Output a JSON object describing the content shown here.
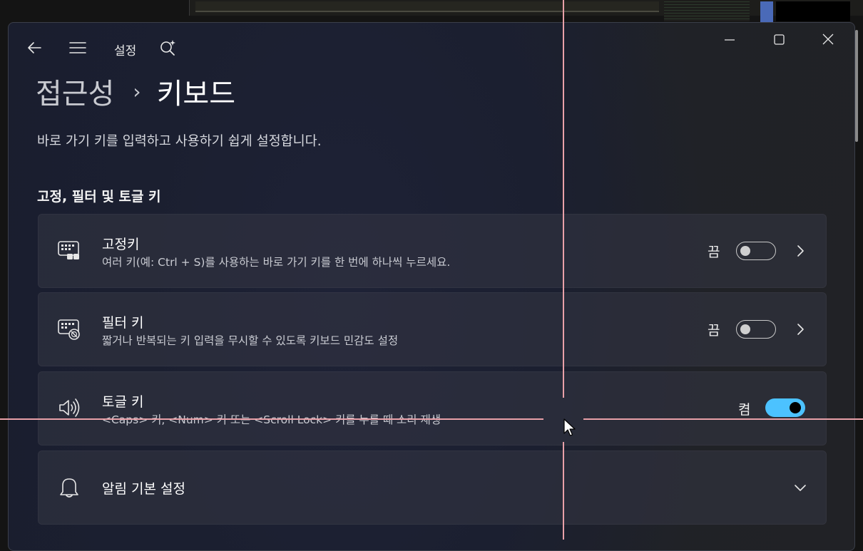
{
  "window": {
    "title": "설정"
  },
  "breadcrumb": {
    "parent": "접근성",
    "separator": "›",
    "current": "키보드"
  },
  "description": "바로 가기 키를 입력하고 사용하기 쉽게 설정합니다.",
  "section": {
    "heading": "고정, 필터 및 토글 키"
  },
  "cards": [
    {
      "icon": "keyboard-sticky-icon",
      "title": "고정키",
      "subtitle": "여러 키(예: Ctrl + S)를 사용하는 바로 가기 키를 한 번에 하나씩 누르세요.",
      "state": "끔",
      "toggle_on": false,
      "has_chevron": true
    },
    {
      "icon": "keyboard-filter-icon",
      "title": "필터 키",
      "subtitle": "짧거나 반복되는 키 입력을 무시할 수 있도록 키보드 민감도 설정",
      "state": "끔",
      "toggle_on": false,
      "has_chevron": true
    },
    {
      "icon": "speaker-icon",
      "title": "토글 키",
      "subtitle": "<Caps> 키, <Num> 키 또는 <Scroll Lock> 키를 누를 때 소리 재생",
      "state": "켬",
      "toggle_on": true,
      "has_chevron": false
    },
    {
      "icon": "bell-icon",
      "title": "알림 기본 설정",
      "expandable": true
    }
  ],
  "colors": {
    "accent": "#4cc2ff",
    "window_bg": "#1c2030",
    "card_bg": "#2d3040",
    "crosshair": "#e8a0a8"
  }
}
